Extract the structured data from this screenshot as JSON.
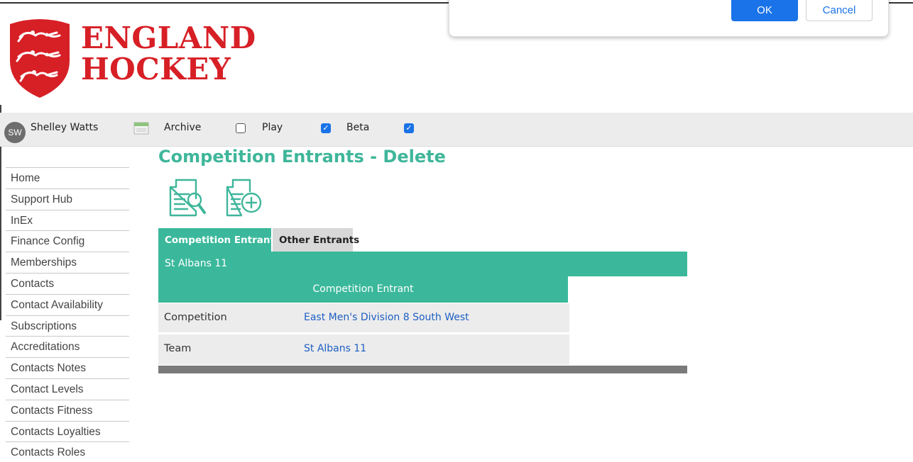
{
  "dialog": {
    "ok_label": "OK",
    "cancel_label": "Cancel"
  },
  "logo": {
    "line1": "ENGLAND",
    "line2": "HOCKEY"
  },
  "toolbar": {
    "user_initials": "SW",
    "user_name": "Shelley Watts",
    "archive_label": "Archive",
    "archive_checked": false,
    "play_label": "Play",
    "play_checked": true,
    "beta_label": "Beta",
    "beta_checked": true
  },
  "sidebar": {
    "items": [
      {
        "label": "Home"
      },
      {
        "label": "Support Hub"
      },
      {
        "label": "InEx"
      },
      {
        "label": "Finance Config"
      },
      {
        "label": "Memberships"
      },
      {
        "label": "Contacts"
      },
      {
        "label": "Contact Availability"
      },
      {
        "label": "Subscriptions"
      },
      {
        "label": "Accreditations"
      },
      {
        "label": "Contacts Notes"
      },
      {
        "label": "Contact Levels"
      },
      {
        "label": "Contacts Fitness"
      },
      {
        "label": "Contacts Loyalties"
      },
      {
        "label": "Contacts Roles"
      }
    ]
  },
  "main": {
    "title": "Competition Entrants - Delete",
    "tabs": [
      {
        "label": "Competition Entrants"
      },
      {
        "label": "Other Entrants"
      }
    ],
    "entrant_name": "St Albans 11",
    "section_header": "Competition Entrant",
    "rows": [
      {
        "label": "Competition",
        "value": "East Men's Division 8 South West"
      },
      {
        "label": "Team",
        "value": "St Albans 11"
      }
    ]
  },
  "colors": {
    "accent": "#3bb89b",
    "title": "#3fb69a",
    "brand_red": "#d71f26",
    "link": "#1f5fc2",
    "checkbox_blue": "#1a73e8"
  },
  "icons": {
    "view": "search-document-icon",
    "add": "add-document-icon"
  }
}
